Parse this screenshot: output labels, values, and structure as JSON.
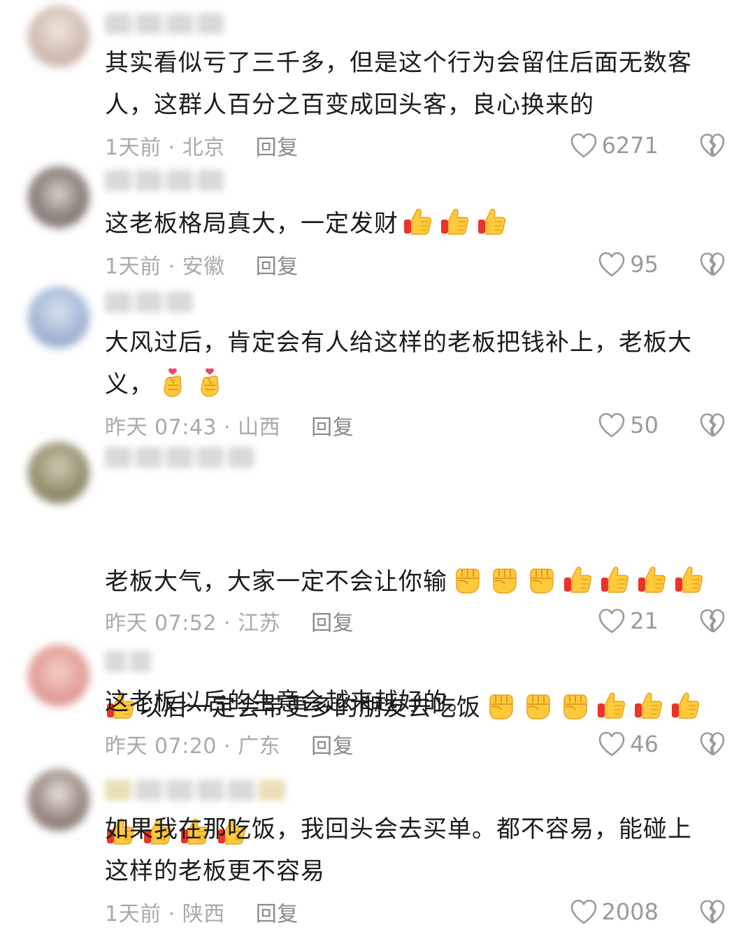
{
  "comments": [
    {
      "lines": [
        "其实看似亏了三千多，但是这个行为会留住后面无数客",
        "人，这群人百分之百变成回头客，良心换来的"
      ],
      "emoji_after": [],
      "time": "1天前 · 北京",
      "reply": "回复",
      "likes": "6271",
      "avatar_color": "#cfc3bd"
    },
    {
      "lines": [
        "这老板格局真大，一定发财"
      ],
      "emoji_after": [
        "thumbs-up",
        "thumbs-up",
        "thumbs-up"
      ],
      "time": "1天前 · 安徽",
      "reply": "回复",
      "likes": "95",
      "avatar_color": "#8a7e78"
    },
    {
      "lines": [
        "大风过后，肯定会有人给这样的老板把钱补上，老板大",
        "义，"
      ],
      "emoji_after": [
        "finger-heart",
        "finger-heart"
      ],
      "time": "昨天 07:43 · 山西",
      "reply": "回复",
      "likes": "50",
      "avatar_color": "#9fb3d4"
    },
    {
      "lines": [
        "老板大气，大家一定不会让你输",
        "以后一定会带更多的朋友去吃饭",
        ""
      ],
      "emoji_after": [],
      "time": "昨天 07:52 · 江苏",
      "reply": "回复",
      "likes": "21",
      "avatar_color": "#8f8a66"
    },
    {
      "lines": [
        "这老板以后的生意会越来越好的。"
      ],
      "emoji_after": [],
      "time": "昨天 07:20 · 广东",
      "reply": "回复",
      "likes": "46",
      "avatar_color": "#e39a94"
    },
    {
      "lines": [
        "如果我在那吃饭，我回头会去买单。都不容易，能碰上",
        "这样的老板更不容易"
      ],
      "emoji_after": [],
      "time": "1天前 · 陕西",
      "reply": "回复",
      "likes": "2008",
      "avatar_color": "#7a6a62"
    }
  ],
  "icons": {
    "like": "heart-outline-icon",
    "dislike": "broken-heart-icon",
    "thumbs_up": "thumbs-up-emoji",
    "fist": "raised-fist-emoji",
    "finger_heart": "finger-heart-emoji"
  },
  "colors": {
    "text": "#1b1b1b",
    "meta": "#a9a9a9",
    "reply": "#8a8a8a",
    "likes": "#9a9a9a"
  }
}
